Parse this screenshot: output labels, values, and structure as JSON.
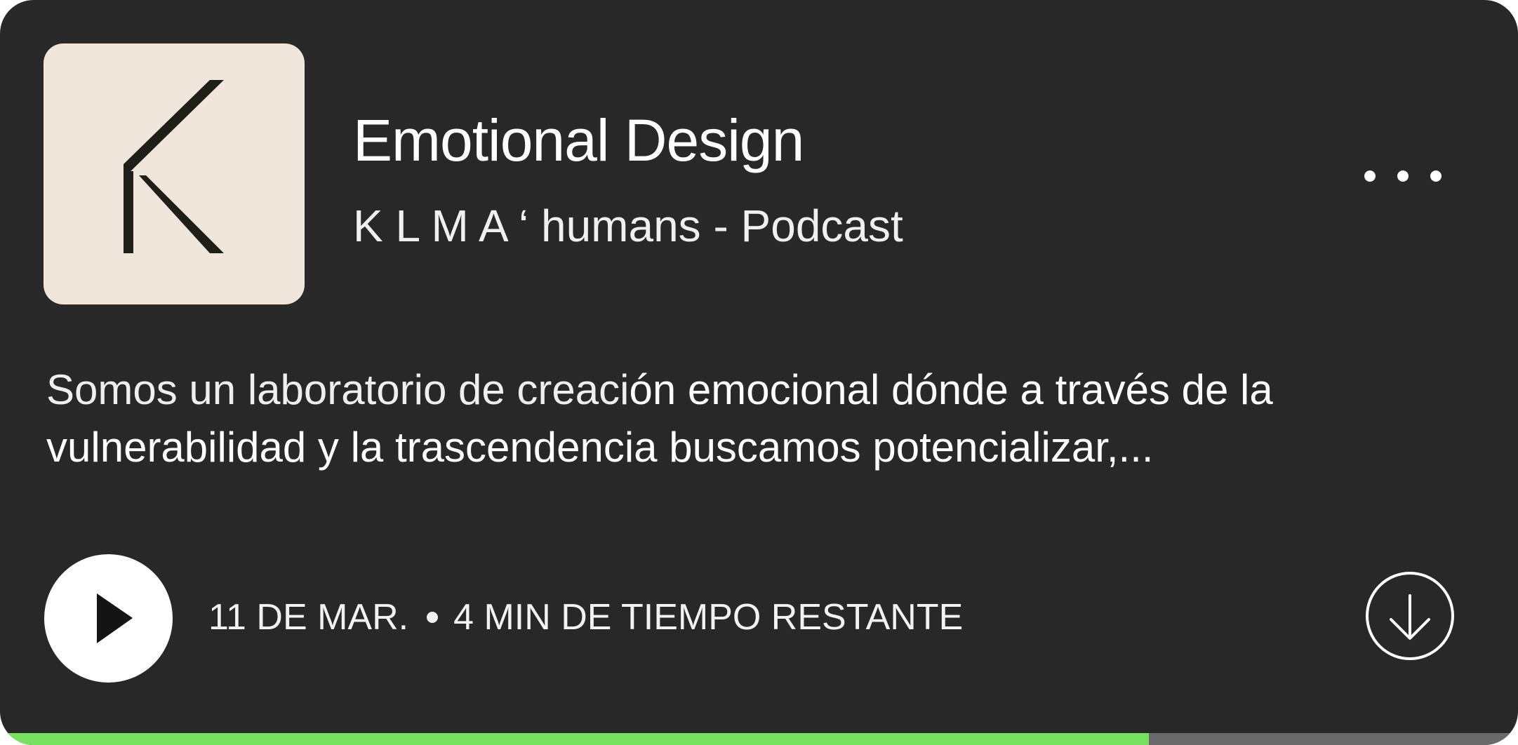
{
  "episode": {
    "title": "Emotional Design",
    "show": "K L M A ‘ humans - Podcast",
    "description_light": "Somos un laboratorio de creaci",
    "description_bold": "ón emocional dónde a través de la vulnerabilidad y la trascendencia buscamos potencializar,...",
    "date": "11 DE MAR.",
    "remaining": "4 MIN DE TIEMPO RESTANTE",
    "progress_fraction": 0.757
  },
  "icons": {
    "artwork": "k-logo-icon",
    "more": "more-dots-icon",
    "play": "play-icon",
    "download": "download-icon"
  },
  "colors": {
    "card_background": "#282828",
    "artwork_background": "#f1e6dc",
    "progress_fill": "#76e05f",
    "progress_track": "#6a6a6a",
    "text": "#ffffff"
  }
}
